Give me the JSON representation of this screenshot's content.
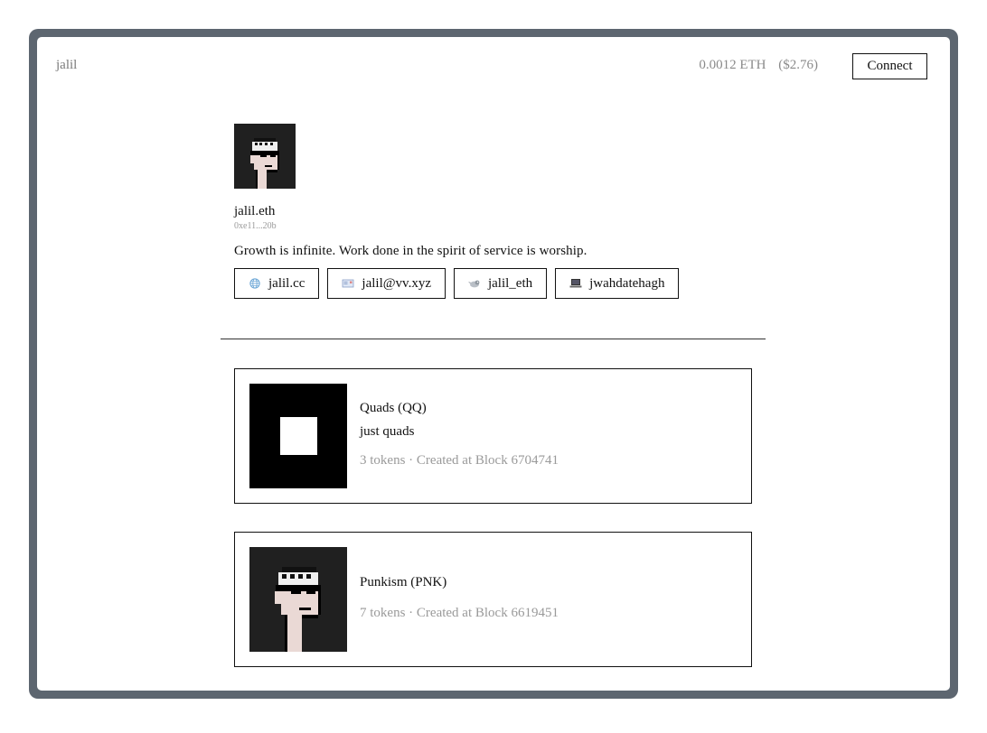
{
  "header": {
    "brand": "jalil",
    "eth_balance": "0.0012 ETH",
    "usd_balance": "($2.76)",
    "connect_label": "Connect"
  },
  "profile": {
    "ens_name": "jalil.eth",
    "address": "0xe11...20b",
    "bio": "Growth is infinite. Work done in the spirit of service is worship.",
    "links": [
      {
        "icon": "globe-icon",
        "label": "jalil.cc"
      },
      {
        "icon": "email-icon",
        "label": "jalil@vv.xyz"
      },
      {
        "icon": "twitter-icon",
        "label": "jalil_eth"
      },
      {
        "icon": "github-icon",
        "label": "jwahdatehagh"
      }
    ]
  },
  "collections": [
    {
      "name": "Quads (QQ)",
      "description": "just quads",
      "meta": "3 tokens · Created at Block 6704741",
      "thumb": "quad-art"
    },
    {
      "name": "Punkism (PNK)",
      "description": "",
      "meta": "7 tokens · Created at Block 6619451",
      "thumb": "punk-art"
    }
  ],
  "colors": {
    "frame": "#5d6670",
    "muted_text": "#9a9a9a",
    "border": "#111111"
  }
}
